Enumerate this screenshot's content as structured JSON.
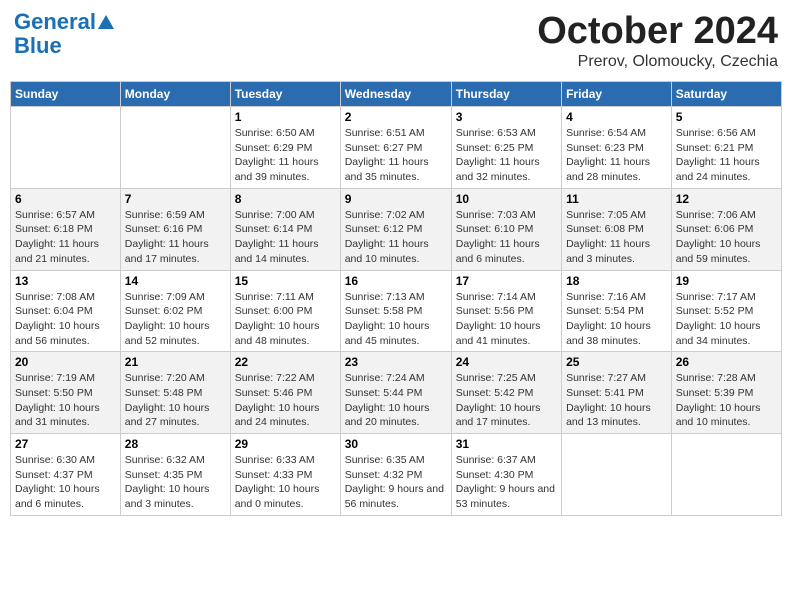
{
  "header": {
    "logo_line1": "General",
    "logo_line2": "Blue",
    "month_title": "October 2024",
    "location": "Prerov, Olomoucky, Czechia"
  },
  "weekdays": [
    "Sunday",
    "Monday",
    "Tuesday",
    "Wednesday",
    "Thursday",
    "Friday",
    "Saturday"
  ],
  "weeks": [
    [
      {
        "day": "",
        "info": ""
      },
      {
        "day": "",
        "info": ""
      },
      {
        "day": "1",
        "info": "Sunrise: 6:50 AM\nSunset: 6:29 PM\nDaylight: 11 hours and 39 minutes."
      },
      {
        "day": "2",
        "info": "Sunrise: 6:51 AM\nSunset: 6:27 PM\nDaylight: 11 hours and 35 minutes."
      },
      {
        "day": "3",
        "info": "Sunrise: 6:53 AM\nSunset: 6:25 PM\nDaylight: 11 hours and 32 minutes."
      },
      {
        "day": "4",
        "info": "Sunrise: 6:54 AM\nSunset: 6:23 PM\nDaylight: 11 hours and 28 minutes."
      },
      {
        "day": "5",
        "info": "Sunrise: 6:56 AM\nSunset: 6:21 PM\nDaylight: 11 hours and 24 minutes."
      }
    ],
    [
      {
        "day": "6",
        "info": "Sunrise: 6:57 AM\nSunset: 6:18 PM\nDaylight: 11 hours and 21 minutes."
      },
      {
        "day": "7",
        "info": "Sunrise: 6:59 AM\nSunset: 6:16 PM\nDaylight: 11 hours and 17 minutes."
      },
      {
        "day": "8",
        "info": "Sunrise: 7:00 AM\nSunset: 6:14 PM\nDaylight: 11 hours and 14 minutes."
      },
      {
        "day": "9",
        "info": "Sunrise: 7:02 AM\nSunset: 6:12 PM\nDaylight: 11 hours and 10 minutes."
      },
      {
        "day": "10",
        "info": "Sunrise: 7:03 AM\nSunset: 6:10 PM\nDaylight: 11 hours and 6 minutes."
      },
      {
        "day": "11",
        "info": "Sunrise: 7:05 AM\nSunset: 6:08 PM\nDaylight: 11 hours and 3 minutes."
      },
      {
        "day": "12",
        "info": "Sunrise: 7:06 AM\nSunset: 6:06 PM\nDaylight: 10 hours and 59 minutes."
      }
    ],
    [
      {
        "day": "13",
        "info": "Sunrise: 7:08 AM\nSunset: 6:04 PM\nDaylight: 10 hours and 56 minutes."
      },
      {
        "day": "14",
        "info": "Sunrise: 7:09 AM\nSunset: 6:02 PM\nDaylight: 10 hours and 52 minutes."
      },
      {
        "day": "15",
        "info": "Sunrise: 7:11 AM\nSunset: 6:00 PM\nDaylight: 10 hours and 48 minutes."
      },
      {
        "day": "16",
        "info": "Sunrise: 7:13 AM\nSunset: 5:58 PM\nDaylight: 10 hours and 45 minutes."
      },
      {
        "day": "17",
        "info": "Sunrise: 7:14 AM\nSunset: 5:56 PM\nDaylight: 10 hours and 41 minutes."
      },
      {
        "day": "18",
        "info": "Sunrise: 7:16 AM\nSunset: 5:54 PM\nDaylight: 10 hours and 38 minutes."
      },
      {
        "day": "19",
        "info": "Sunrise: 7:17 AM\nSunset: 5:52 PM\nDaylight: 10 hours and 34 minutes."
      }
    ],
    [
      {
        "day": "20",
        "info": "Sunrise: 7:19 AM\nSunset: 5:50 PM\nDaylight: 10 hours and 31 minutes."
      },
      {
        "day": "21",
        "info": "Sunrise: 7:20 AM\nSunset: 5:48 PM\nDaylight: 10 hours and 27 minutes."
      },
      {
        "day": "22",
        "info": "Sunrise: 7:22 AM\nSunset: 5:46 PM\nDaylight: 10 hours and 24 minutes."
      },
      {
        "day": "23",
        "info": "Sunrise: 7:24 AM\nSunset: 5:44 PM\nDaylight: 10 hours and 20 minutes."
      },
      {
        "day": "24",
        "info": "Sunrise: 7:25 AM\nSunset: 5:42 PM\nDaylight: 10 hours and 17 minutes."
      },
      {
        "day": "25",
        "info": "Sunrise: 7:27 AM\nSunset: 5:41 PM\nDaylight: 10 hours and 13 minutes."
      },
      {
        "day": "26",
        "info": "Sunrise: 7:28 AM\nSunset: 5:39 PM\nDaylight: 10 hours and 10 minutes."
      }
    ],
    [
      {
        "day": "27",
        "info": "Sunrise: 6:30 AM\nSunset: 4:37 PM\nDaylight: 10 hours and 6 minutes."
      },
      {
        "day": "28",
        "info": "Sunrise: 6:32 AM\nSunset: 4:35 PM\nDaylight: 10 hours and 3 minutes."
      },
      {
        "day": "29",
        "info": "Sunrise: 6:33 AM\nSunset: 4:33 PM\nDaylight: 10 hours and 0 minutes."
      },
      {
        "day": "30",
        "info": "Sunrise: 6:35 AM\nSunset: 4:32 PM\nDaylight: 9 hours and 56 minutes."
      },
      {
        "day": "31",
        "info": "Sunrise: 6:37 AM\nSunset: 4:30 PM\nDaylight: 9 hours and 53 minutes."
      },
      {
        "day": "",
        "info": ""
      },
      {
        "day": "",
        "info": ""
      }
    ]
  ]
}
